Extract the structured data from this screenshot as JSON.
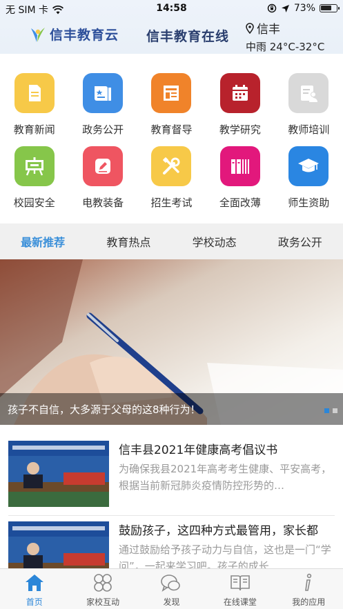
{
  "status_bar": {
    "carrier": "无 SIM 卡",
    "time": "14:58",
    "battery": "73%",
    "battery_level": 0.73
  },
  "header": {
    "brand": "信丰教育云",
    "title": "信丰教育在线",
    "city": "信丰",
    "weather": "中雨 24°C-32°C"
  },
  "grid": [
    {
      "label": "教育新闻",
      "color": "#f7c948",
      "icon": "document-icon"
    },
    {
      "label": "政务公开",
      "color": "#3f8ee5",
      "icon": "book-star-icon"
    },
    {
      "label": "教育督导",
      "color": "#f0832a",
      "icon": "newspaper-icon"
    },
    {
      "label": "教学研究",
      "color": "#b8222c",
      "icon": "calendar-icon"
    },
    {
      "label": "教师培训",
      "color": "#d9d9d9",
      "icon": "teacher-icon"
    },
    {
      "label": "校园安全",
      "color": "#86c64a",
      "icon": "board-icon"
    },
    {
      "label": "电教装备",
      "color": "#ef5561",
      "icon": "pencil-box-icon"
    },
    {
      "label": "招生考试",
      "color": "#f7c948",
      "icon": "tools-icon"
    },
    {
      "label": "全面改薄",
      "color": "#e2187c",
      "icon": "books-icon"
    },
    {
      "label": "师生资助",
      "color": "#2a86e2",
      "icon": "graduation-cap-icon"
    }
  ],
  "tabs": [
    "最新推荐",
    "教育热点",
    "学校动态",
    "政务公开"
  ],
  "banner": {
    "caption": "孩子不自信，大多源于父母的这8种行为！"
  },
  "news": [
    {
      "title": "信丰县2021年健康高考倡议书",
      "desc": "为确保我县2021年高考考生健康、平安高考，根据当前新冠肺炎疫情防控形势的…"
    },
    {
      "title": "鼓励孩子，这四种方式最管用，家长都",
      "desc": "通过鼓励给予孩子动力与自信，这也是一门“学问”，一起来学习吧。孩子的成长…"
    }
  ],
  "bottom_nav": [
    "首页",
    "家校互动",
    "发现",
    "在线课堂",
    "我的应用"
  ],
  "colors": {
    "accent": "#2b86d8",
    "tabs_bg": "#f0f0f0"
  }
}
